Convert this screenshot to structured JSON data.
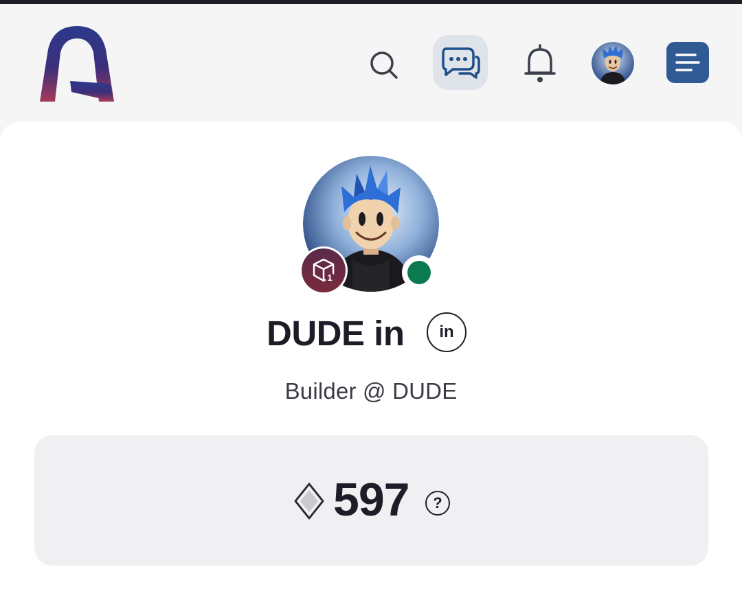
{
  "header": {
    "logo": "app-logo",
    "icons": {
      "search": "search-icon",
      "messages": "chat-bubbles-icon",
      "notifications": "bell-icon",
      "menu": "hamburger-menu-icon"
    }
  },
  "profile": {
    "name": "DUDE in",
    "headline": "Builder @ DUDE",
    "level_badge": "1",
    "status": "online",
    "social": {
      "linkedin_label": "in"
    }
  },
  "points": {
    "value": "597",
    "help_label": "?"
  },
  "colors": {
    "brand_navy": "#2f5a94",
    "logo_top": "#2b3a8c",
    "logo_bottom": "#a33a5a",
    "online": "#0b7a4f",
    "badge": "#6a2a44"
  }
}
